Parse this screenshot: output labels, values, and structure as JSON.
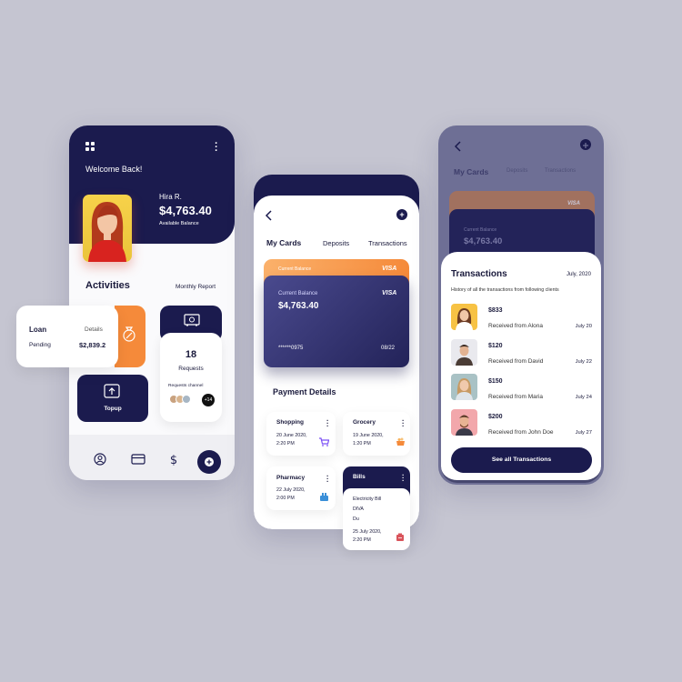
{
  "phone1": {
    "welcome": "Welcome Back!",
    "user_name": "Hira R.",
    "balance": "$4,763.40",
    "balance_label": "Available Balance",
    "activities_title": "Activities",
    "monthly_report": "Monthly Report",
    "loan": {
      "title": "Loan",
      "details": "Details",
      "status": "Pending",
      "amount": "$2,839.2"
    },
    "requests": {
      "count": "18",
      "label": "Requests",
      "channel_label": "Requests channel",
      "extra": "+14"
    },
    "topup_label": "Topup",
    "icons": [
      "grid-menu-icon",
      "more-vertical-icon",
      "money-bag-icon",
      "safe-icon",
      "topup-icon",
      "profile-icon",
      "card-icon",
      "dollar-icon",
      "plus-icon"
    ]
  },
  "phone2": {
    "tabs": [
      "My Cards",
      "Deposits",
      "Transactions"
    ],
    "back_card": {
      "label": "Current Balance",
      "brand": "VISA"
    },
    "front_card": {
      "label": "Current Balance",
      "brand": "VISA",
      "amount": "$4,763.40",
      "number": "******0975",
      "expiry": "08/22"
    },
    "payment_title": "Payment Details",
    "payments": [
      {
        "title": "Shopping",
        "date": "20 June 2020,",
        "time": "2:20 PM",
        "icon": "cart-icon"
      },
      {
        "title": "Grocery",
        "date": "19 June 2020,",
        "time": "1:20 PM",
        "icon": "basket-icon"
      },
      {
        "title": "Pharmacy",
        "date": "22 July 2020,",
        "time": "2:00 PM",
        "icon": "pharmacy-icon"
      }
    ],
    "bills": {
      "title": "Bills",
      "items": [
        "Electricity Bill",
        "DIVA",
        "Du"
      ],
      "date": "25 July 2020,",
      "time": "2:20 PM",
      "icon": "bill-icon"
    }
  },
  "phone3": {
    "header_title": "My Cards",
    "tabs": [
      "Deposits",
      "Transactions"
    ],
    "card_brand": "VISA",
    "card_label": "Current Balance",
    "card_amount": "$4,763.40",
    "sheet_title": "Transactions",
    "sheet_date": "July, 2020",
    "sheet_subtitle": "History of all the transactions from following clients",
    "transactions": [
      {
        "amount": "$833",
        "from": "Received from Alona",
        "date": "July 20",
        "avatar_color": "#f7c244"
      },
      {
        "amount": "$120",
        "from": "Received from David",
        "date": "July 22",
        "avatar_color": "#e9e9ee"
      },
      {
        "amount": "$150",
        "from": "Received from Maria",
        "date": "July 24",
        "avatar_color": "#a9c2c5"
      },
      {
        "amount": "$200",
        "from": "Received from John Doe",
        "date": "July 27",
        "avatar_color": "#f2a7ab"
      }
    ],
    "button_label": "See all Transactions"
  },
  "colors": {
    "navy": "#1b1b4e",
    "orange": "#f58a3a",
    "background": "#c5c5d1"
  }
}
